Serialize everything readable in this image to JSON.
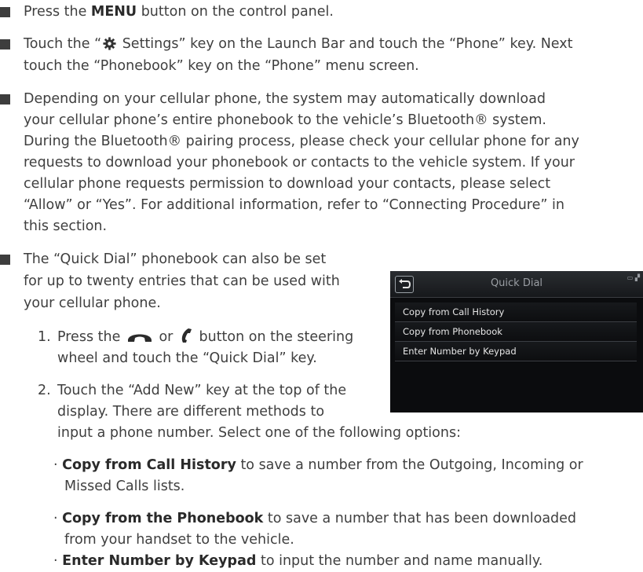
{
  "bullets": [
    {
      "lines": [
        {
          "pre": "Press the ",
          "bold": "MENU",
          "post": " button on the control panel."
        }
      ]
    },
    {
      "line1_pre": "Touch the “",
      "line1_post": " Settings” key on the Launch Bar and touch the “Phone” key. Next",
      "line2": "touch the “Phonebook” key on the “Phone” menu screen."
    },
    {
      "lines": [
        "Depending on your cellular phone, the system may automatically download",
        "your cellular phone’s entire phonebook to the vehicle’s Bluetooth® system.",
        "During the Bluetooth® pairing process, please check your cellular phone for any",
        "requests to download your phonebook or contacts to the vehicle system. If your",
        "cellular phone requests permission to download your contacts, please select",
        "“Allow” or “Yes”. For additional information, refer to “Connecting Procedure” in",
        "this section."
      ]
    },
    {
      "lines": [
        "The “Quick Dial” phonebook can also be set",
        "for up to twenty entries that can be used with",
        "your cellular phone."
      ]
    }
  ],
  "steps": [
    {
      "num": "1.",
      "line1_pre": "Press the ",
      "line1_mid": " or ",
      "line1_post": " button on the steering",
      "line2": "wheel and touch the “Quick Dial” key."
    },
    {
      "num": "2.",
      "lines": [
        "Touch the “Add New” key at the top of the",
        "display. There are different methods to"
      ],
      "line3": "input a phone number. Select one of the following options:"
    }
  ],
  "options": [
    {
      "bold": "Copy from Call History",
      "text": " to save a number from the Outgoing, Incoming or",
      "line2": "Missed Calls lists."
    },
    {
      "bold": "Copy from the Phonebook",
      "text": " to save a number that has been downloaded",
      "line2": "from your handset to the vehicle."
    },
    {
      "bold": "Enter Number by Keypad",
      "text": " to input the number and name manually."
    }
  ],
  "option_marker": "·",
  "screen": {
    "title": "Quick Dial",
    "status": "▭ ▞",
    "items": [
      "Copy from Call History",
      "Copy from Phonebook",
      "Enter Number by Keypad"
    ]
  }
}
